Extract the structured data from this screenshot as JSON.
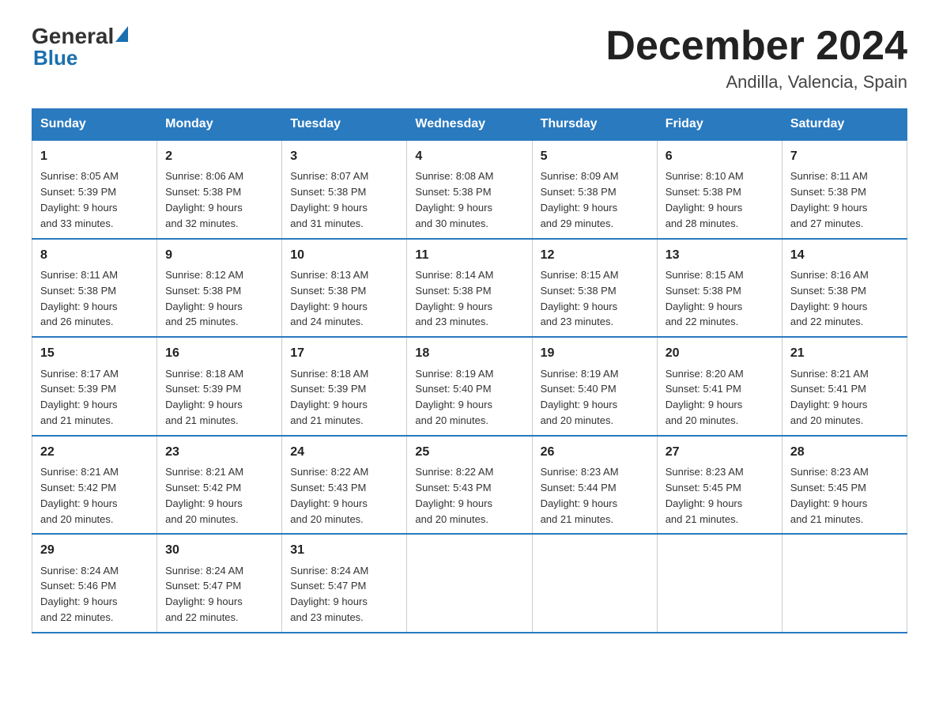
{
  "header": {
    "title": "December 2024",
    "location": "Andilla, Valencia, Spain",
    "logo_general": "General",
    "logo_blue": "Blue"
  },
  "days_of_week": [
    "Sunday",
    "Monday",
    "Tuesday",
    "Wednesday",
    "Thursday",
    "Friday",
    "Saturday"
  ],
  "weeks": [
    [
      {
        "num": "1",
        "sunrise": "8:05 AM",
        "sunset": "5:39 PM",
        "daylight": "9 hours and 33 minutes."
      },
      {
        "num": "2",
        "sunrise": "8:06 AM",
        "sunset": "5:38 PM",
        "daylight": "9 hours and 32 minutes."
      },
      {
        "num": "3",
        "sunrise": "8:07 AM",
        "sunset": "5:38 PM",
        "daylight": "9 hours and 31 minutes."
      },
      {
        "num": "4",
        "sunrise": "8:08 AM",
        "sunset": "5:38 PM",
        "daylight": "9 hours and 30 minutes."
      },
      {
        "num": "5",
        "sunrise": "8:09 AM",
        "sunset": "5:38 PM",
        "daylight": "9 hours and 29 minutes."
      },
      {
        "num": "6",
        "sunrise": "8:10 AM",
        "sunset": "5:38 PM",
        "daylight": "9 hours and 28 minutes."
      },
      {
        "num": "7",
        "sunrise": "8:11 AM",
        "sunset": "5:38 PM",
        "daylight": "9 hours and 27 minutes."
      }
    ],
    [
      {
        "num": "8",
        "sunrise": "8:11 AM",
        "sunset": "5:38 PM",
        "daylight": "9 hours and 26 minutes."
      },
      {
        "num": "9",
        "sunrise": "8:12 AM",
        "sunset": "5:38 PM",
        "daylight": "9 hours and 25 minutes."
      },
      {
        "num": "10",
        "sunrise": "8:13 AM",
        "sunset": "5:38 PM",
        "daylight": "9 hours and 24 minutes."
      },
      {
        "num": "11",
        "sunrise": "8:14 AM",
        "sunset": "5:38 PM",
        "daylight": "9 hours and 23 minutes."
      },
      {
        "num": "12",
        "sunrise": "8:15 AM",
        "sunset": "5:38 PM",
        "daylight": "9 hours and 23 minutes."
      },
      {
        "num": "13",
        "sunrise": "8:15 AM",
        "sunset": "5:38 PM",
        "daylight": "9 hours and 22 minutes."
      },
      {
        "num": "14",
        "sunrise": "8:16 AM",
        "sunset": "5:38 PM",
        "daylight": "9 hours and 22 minutes."
      }
    ],
    [
      {
        "num": "15",
        "sunrise": "8:17 AM",
        "sunset": "5:39 PM",
        "daylight": "9 hours and 21 minutes."
      },
      {
        "num": "16",
        "sunrise": "8:18 AM",
        "sunset": "5:39 PM",
        "daylight": "9 hours and 21 minutes."
      },
      {
        "num": "17",
        "sunrise": "8:18 AM",
        "sunset": "5:39 PM",
        "daylight": "9 hours and 21 minutes."
      },
      {
        "num": "18",
        "sunrise": "8:19 AM",
        "sunset": "5:40 PM",
        "daylight": "9 hours and 20 minutes."
      },
      {
        "num": "19",
        "sunrise": "8:19 AM",
        "sunset": "5:40 PM",
        "daylight": "9 hours and 20 minutes."
      },
      {
        "num": "20",
        "sunrise": "8:20 AM",
        "sunset": "5:41 PM",
        "daylight": "9 hours and 20 minutes."
      },
      {
        "num": "21",
        "sunrise": "8:21 AM",
        "sunset": "5:41 PM",
        "daylight": "9 hours and 20 minutes."
      }
    ],
    [
      {
        "num": "22",
        "sunrise": "8:21 AM",
        "sunset": "5:42 PM",
        "daylight": "9 hours and 20 minutes."
      },
      {
        "num": "23",
        "sunrise": "8:21 AM",
        "sunset": "5:42 PM",
        "daylight": "9 hours and 20 minutes."
      },
      {
        "num": "24",
        "sunrise": "8:22 AM",
        "sunset": "5:43 PM",
        "daylight": "9 hours and 20 minutes."
      },
      {
        "num": "25",
        "sunrise": "8:22 AM",
        "sunset": "5:43 PM",
        "daylight": "9 hours and 20 minutes."
      },
      {
        "num": "26",
        "sunrise": "8:23 AM",
        "sunset": "5:44 PM",
        "daylight": "9 hours and 21 minutes."
      },
      {
        "num": "27",
        "sunrise": "8:23 AM",
        "sunset": "5:45 PM",
        "daylight": "9 hours and 21 minutes."
      },
      {
        "num": "28",
        "sunrise": "8:23 AM",
        "sunset": "5:45 PM",
        "daylight": "9 hours and 21 minutes."
      }
    ],
    [
      {
        "num": "29",
        "sunrise": "8:24 AM",
        "sunset": "5:46 PM",
        "daylight": "9 hours and 22 minutes."
      },
      {
        "num": "30",
        "sunrise": "8:24 AM",
        "sunset": "5:47 PM",
        "daylight": "9 hours and 22 minutes."
      },
      {
        "num": "31",
        "sunrise": "8:24 AM",
        "sunset": "5:47 PM",
        "daylight": "9 hours and 23 minutes."
      },
      null,
      null,
      null,
      null
    ]
  ],
  "labels": {
    "sunrise": "Sunrise:",
    "sunset": "Sunset:",
    "daylight": "Daylight:"
  }
}
